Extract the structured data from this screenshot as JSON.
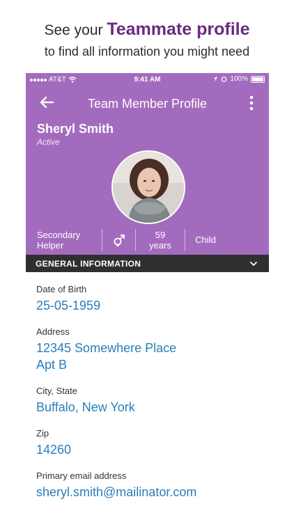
{
  "promo": {
    "line1_prefix": "See your ",
    "line1_accent": "Teammate profile",
    "line2": "to find all information you might need"
  },
  "statusbar": {
    "carrier": "AT&T",
    "time": "9:41 AM",
    "battery": "100%"
  },
  "topbar": {
    "title": "Team Member Profile"
  },
  "profile": {
    "name": "Sheryl Smith",
    "status": "Active",
    "role_line1": "Secondary",
    "role_line2": "Helper",
    "age_value": "59",
    "age_unit": "years",
    "relation": "Child"
  },
  "section": {
    "title": "GENERAL INFORMATION"
  },
  "fields": {
    "dob_label": "Date of Birth",
    "dob_value": "25-05-1959",
    "address_label": "Address",
    "address_line1": "12345 Somewhere Place",
    "address_line2": "Apt B",
    "city_label": "City, State",
    "city_value": "Buffalo, New York",
    "zip_label": "Zip",
    "zip_value": "14260",
    "email_label": "Primary email address",
    "email_value": "sheryl.smith@mailinator.com"
  },
  "colors": {
    "header": "#a36bbd",
    "accent": "#6a2a83",
    "section_bar": "#2f2f2f",
    "value": "#2a7db8"
  },
  "icons": [
    "back-arrow-icon",
    "more-vert-icon",
    "gender-icon",
    "chevron-down-icon",
    "wifi-icon",
    "battery-icon"
  ]
}
